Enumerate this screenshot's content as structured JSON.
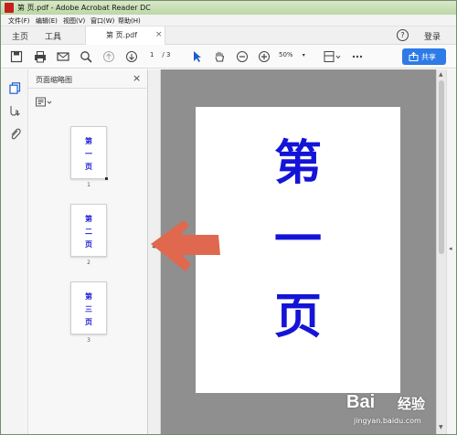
{
  "window": {
    "title": "第 页.pdf - Adobe Acrobat Reader DC"
  },
  "menu": [
    "文件(F)",
    "编辑(E)",
    "视图(V)",
    "窗口(W)",
    "帮助(H)"
  ],
  "tabs": {
    "home": "主页",
    "tools": "工具",
    "document": "第 页.pdf",
    "help": "?",
    "login": "登录"
  },
  "toolbar": {
    "page_current": "1",
    "page_total": "/ 3",
    "zoom": "50%",
    "share_label": "共享"
  },
  "panel": {
    "title": "页面缩略图",
    "thumbnails": [
      {
        "chars": [
          "第",
          "一",
          "页"
        ],
        "number": "1"
      },
      {
        "chars": [
          "第",
          "二",
          "页"
        ],
        "number": "2"
      },
      {
        "chars": [
          "第",
          "三",
          "页"
        ],
        "number": "3"
      }
    ]
  },
  "page": {
    "chars": [
      "第",
      "一",
      "页"
    ]
  },
  "watermark": {
    "brand": "Bai",
    "suffix": "经验",
    "url": "jingyan.baidu.com"
  },
  "colors": {
    "accent": "#2e7be8",
    "page_text": "#1414d8",
    "arrow": "#e0684e"
  }
}
